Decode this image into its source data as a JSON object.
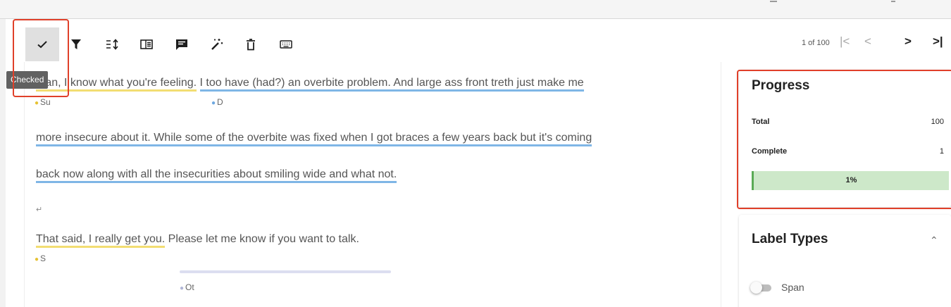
{
  "toolbar": {
    "tools": [
      {
        "name": "checked",
        "icon": "check-icon",
        "active": true
      },
      {
        "name": "filter",
        "icon": "filter-icon"
      },
      {
        "name": "sort",
        "icon": "sort-icon"
      },
      {
        "name": "layout",
        "icon": "layout-icon"
      },
      {
        "name": "comment",
        "icon": "comment-icon"
      },
      {
        "name": "auto-label",
        "icon": "magic-wand-icon"
      },
      {
        "name": "delete",
        "icon": "trash-icon"
      },
      {
        "name": "keyboard",
        "icon": "keyboard-icon"
      }
    ],
    "tooltip": "Checked"
  },
  "pager": {
    "text": "1 of 100",
    "first": "|<",
    "prev": "<",
    "next": ">",
    "last": ">|"
  },
  "document": {
    "l1_a": "Man, I know what you're feeling.",
    "l1_b": "I too have (had?) an overbite problem. And large ass front treth just make me",
    "l1_lbl_a": "Su",
    "l1_lbl_b": "D",
    "l2": "more insecure about it. While some of the overbite was fixed when I got braces a few years back but it's coming",
    "l3": "back now along with all the insecurities about smiling wide and what not.",
    "para_mark": "↵",
    "l5_a": "That said, I really get you.",
    "l5_b": " Please let me know if you want to talk.",
    "l5_lbl": "S",
    "rel_lbl": "Ot"
  },
  "progress": {
    "title": "Progress",
    "total_label": "Total",
    "total_value": "100",
    "complete_label": "Complete",
    "complete_value": "1",
    "percent": 1,
    "percent_text": "1%"
  },
  "label_types": {
    "title": "Label Types",
    "toggle_label": "Span",
    "toggle_on": false
  },
  "colors": {
    "highlight": "#e0402a",
    "span_yellow": "#f2dd72",
    "span_blue": "#7fb6e6",
    "progress_fill": "#cde8c9"
  }
}
